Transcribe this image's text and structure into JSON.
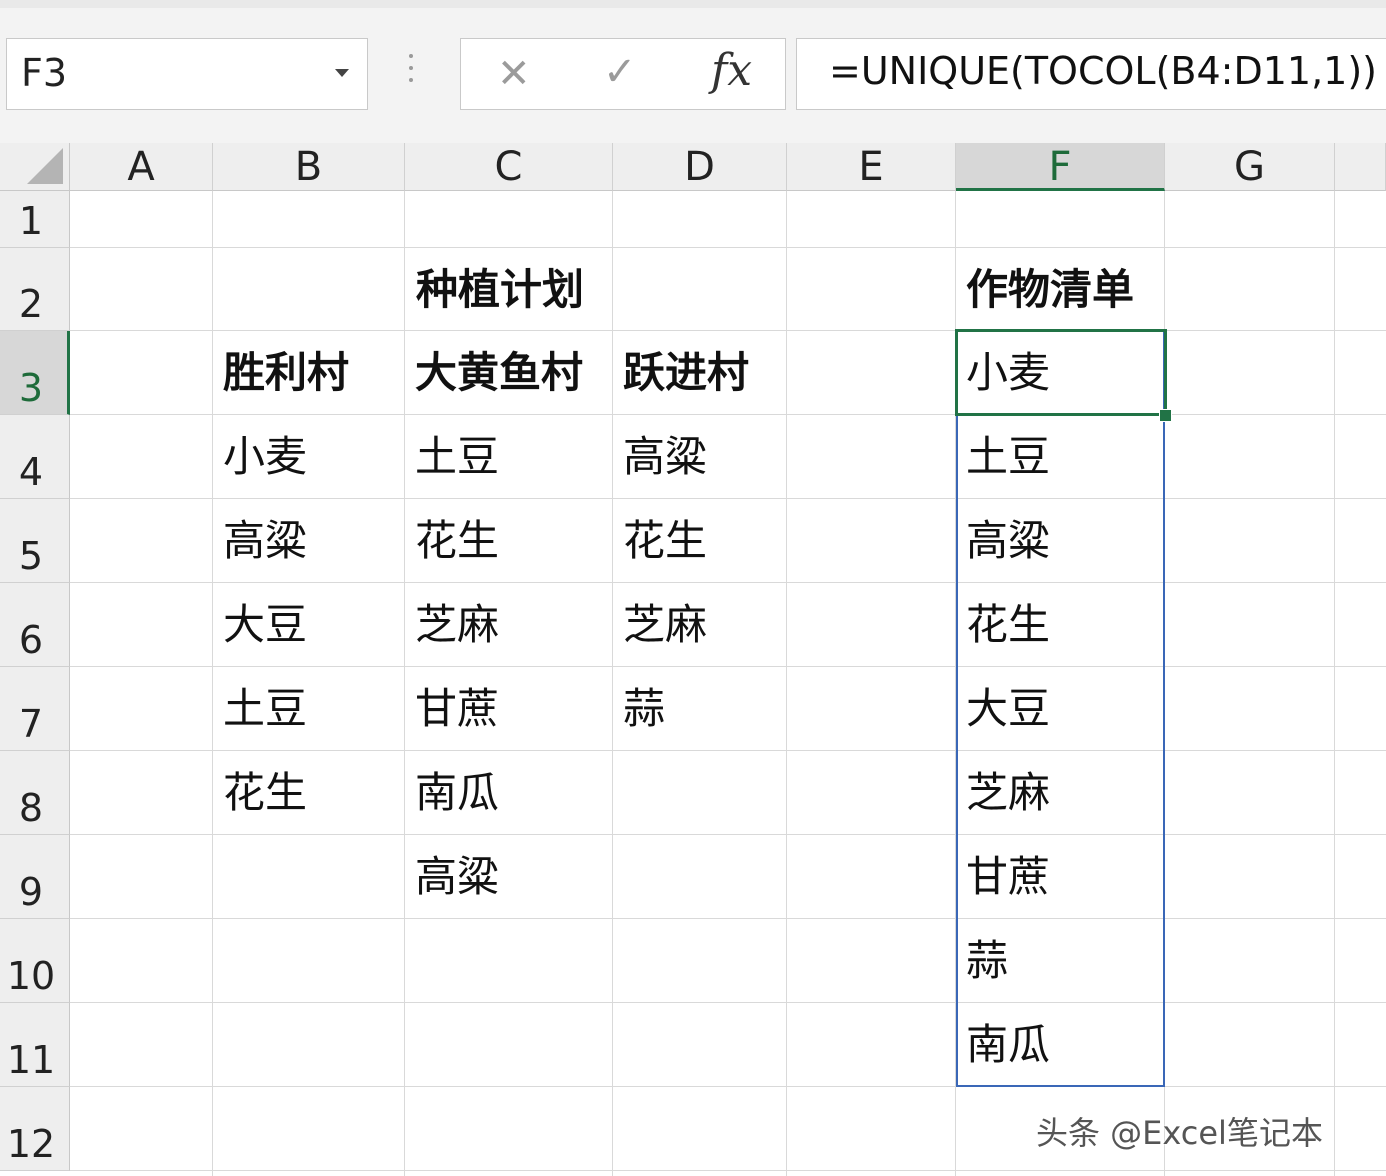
{
  "name_box": {
    "value": "F3"
  },
  "formula_bar": {
    "cancel_symbol": "✕",
    "enter_symbol": "✓",
    "fx_label": "fx",
    "formula": "=UNIQUE(TOCOL(B4:D11,1))"
  },
  "columns": [
    "A",
    "B",
    "C",
    "D",
    "E",
    "F",
    "G"
  ],
  "selected_column": "F",
  "rows": [
    "1",
    "2",
    "3",
    "4",
    "5",
    "6",
    "7",
    "8",
    "9",
    "10",
    "11",
    "12"
  ],
  "selected_row": "3",
  "sheet": {
    "plan_title": "种植计划",
    "headers": {
      "B": "胜利村",
      "C": "大黄鱼村",
      "D": "跃进村"
    },
    "B": [
      "小麦",
      "高粱",
      "大豆",
      "土豆",
      "花生"
    ],
    "C": [
      "土豆",
      "花生",
      "芝麻",
      "甘蔗",
      "南瓜",
      "高粱"
    ],
    "D": [
      "高粱",
      "花生",
      "芝麻",
      "蒜"
    ],
    "list_title": "作物清单",
    "F": [
      "小麦",
      "土豆",
      "高粱",
      "花生",
      "大豆",
      "芝麻",
      "甘蔗",
      "蒜",
      "南瓜"
    ]
  },
  "watermark": "头条 @Excel笔记本",
  "colors": {
    "accent_green": "#217346",
    "spill_blue": "#3a67b7"
  },
  "icons": [
    "dropdown-arrow-icon",
    "cancel-icon",
    "enter-icon",
    "fx-icon"
  ]
}
